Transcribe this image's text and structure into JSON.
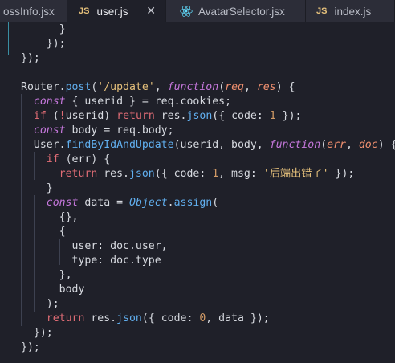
{
  "tabs": [
    {
      "label": "ossInfo.jsx",
      "active": false
    },
    {
      "badge": "JS",
      "label": "user.js",
      "active": true,
      "close": "✕"
    },
    {
      "label": "AvatarSelector.jsx",
      "active": false
    },
    {
      "badge": "JS",
      "label": "index.js",
      "active": false
    }
  ],
  "code": [
    [
      [
        "p",
        "      }"
      ]
    ],
    [
      [
        "p",
        "    });"
      ]
    ],
    [
      [
        "p",
        "});"
      ]
    ],
    [
      [
        "p",
        ""
      ]
    ],
    [
      [
        "p",
        "Router."
      ],
      [
        "fn",
        "post"
      ],
      [
        "p",
        "("
      ],
      [
        "str",
        "'/update'"
      ],
      [
        "p",
        ", "
      ],
      [
        "kw",
        "function"
      ],
      [
        "p",
        "("
      ],
      [
        "par",
        "req"
      ],
      [
        "p",
        ", "
      ],
      [
        "par",
        "res"
      ],
      [
        "p",
        ") {"
      ]
    ],
    [
      [
        "p",
        "  "
      ],
      [
        "kw",
        "const"
      ],
      [
        "p",
        " { userid } = req.cookies;"
      ]
    ],
    [
      [
        "p",
        "  "
      ],
      [
        "kw2",
        "if"
      ],
      [
        "p",
        " ("
      ],
      [
        "kw2",
        "!"
      ],
      [
        "p",
        "userid) "
      ],
      [
        "kw2",
        "return"
      ],
      [
        "p",
        " res."
      ],
      [
        "fn",
        "json"
      ],
      [
        "p",
        "({ code: "
      ],
      [
        "num",
        "1"
      ],
      [
        "p",
        " });"
      ]
    ],
    [
      [
        "p",
        "  "
      ],
      [
        "kw",
        "const"
      ],
      [
        "p",
        " body = req.body;"
      ]
    ],
    [
      [
        "p",
        "  User."
      ],
      [
        "fn",
        "findByIdAndUpdate"
      ],
      [
        "p",
        "(userid, body, "
      ],
      [
        "kw",
        "function"
      ],
      [
        "p",
        "("
      ],
      [
        "par",
        "err"
      ],
      [
        "p",
        ", "
      ],
      [
        "par",
        "doc"
      ],
      [
        "p",
        ") {"
      ]
    ],
    [
      [
        "p",
        "    "
      ],
      [
        "kw2",
        "if"
      ],
      [
        "p",
        " (err) {"
      ]
    ],
    [
      [
        "p",
        "      "
      ],
      [
        "kw2",
        "return"
      ],
      [
        "p",
        " res."
      ],
      [
        "fn",
        "json"
      ],
      [
        "p",
        "({ code: "
      ],
      [
        "num",
        "1"
      ],
      [
        "p",
        ", msg: "
      ],
      [
        "str",
        "'后端出错了'"
      ],
      [
        "p",
        " });"
      ]
    ],
    [
      [
        "p",
        "    }"
      ]
    ],
    [
      [
        "p",
        "    "
      ],
      [
        "kw",
        "const"
      ],
      [
        "p",
        " data = "
      ],
      [
        "cls",
        "Object"
      ],
      [
        "p",
        "."
      ],
      [
        "fn",
        "assign"
      ],
      [
        "p",
        "("
      ]
    ],
    [
      [
        "p",
        "      {},"
      ]
    ],
    [
      [
        "p",
        "      {"
      ]
    ],
    [
      [
        "p",
        "        user: doc.user,"
      ]
    ],
    [
      [
        "p",
        "        type: doc.type"
      ]
    ],
    [
      [
        "p",
        "      },"
      ]
    ],
    [
      [
        "p",
        "      body"
      ]
    ],
    [
      [
        "p",
        "    );"
      ]
    ],
    [
      [
        "p",
        "    "
      ],
      [
        "kw2",
        "return"
      ],
      [
        "p",
        " res."
      ],
      [
        "fn",
        "json"
      ],
      [
        "p",
        "({ code: "
      ],
      [
        "num",
        "0"
      ],
      [
        "p",
        ", data });"
      ]
    ],
    [
      [
        "p",
        "  });"
      ]
    ],
    [
      [
        "p",
        "});"
      ]
    ]
  ]
}
